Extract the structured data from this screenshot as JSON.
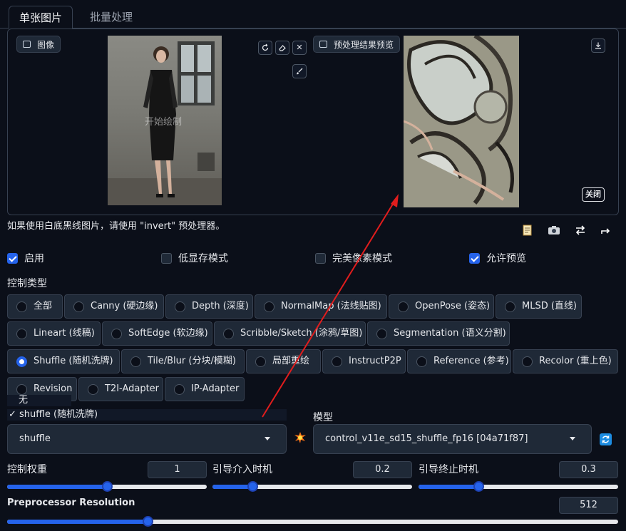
{
  "tabs": {
    "single": "单张图片",
    "batch": "批量处理"
  },
  "input_panel": {
    "label": "图像",
    "overlay": "开始绘制",
    "close_label": "关闭"
  },
  "preview_panel": {
    "label": "预处理结果预览"
  },
  "note": "如果使用白底黑线图片，请使用 \"invert\" 预处理器。",
  "options": {
    "enable": "启用",
    "low_vram": "低显存模式",
    "pixel_perfect": "完美像素模式",
    "allow_preview": "允许预览"
  },
  "control_type_label": "控制类型",
  "control_types": [
    "全部",
    "Canny (硬边缘)",
    "Depth (深度)",
    "NormalMap (法线贴图)",
    "OpenPose (姿态)",
    "MLSD (直线)",
    "Lineart (线稿)",
    "SoftEdge (软边缘)",
    "Scribble/Sketch (涂鸦/草图)",
    "Segmentation (语义分割)",
    "Shuffle (随机洗牌)",
    "Tile/Blur (分块/模糊)",
    "局部重绘",
    "InstructP2P",
    "Reference (参考)",
    "Recolor (重上色)",
    "Revision",
    "T2I-Adapter",
    "IP-Adapter"
  ],
  "dropdown_options": {
    "none": "无",
    "selected": "✓ shuffle (随机洗牌)"
  },
  "preprocessor_value": "shuffle",
  "model_label": "模型",
  "model_value": "control_v11e_sd15_shuffle_fp16 [04a71f87]",
  "sliders": {
    "weight": {
      "label": "控制权重",
      "value": "1",
      "fraction": 0.5
    },
    "start": {
      "label": "引导介入时机",
      "value": "0.2",
      "fraction": 0.2
    },
    "end": {
      "label": "引导终止时机",
      "value": "0.3",
      "fraction": 0.3
    },
    "resolution": {
      "label": "Preprocessor Resolution",
      "value": "512",
      "fraction": 0.23
    }
  },
  "colors": {
    "accent": "#2563eb",
    "background": "#0b0f19",
    "annotation_arrow": "#e11d1d"
  }
}
